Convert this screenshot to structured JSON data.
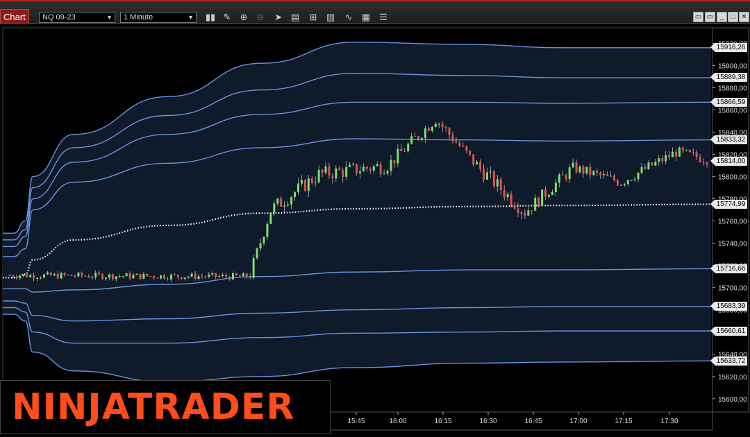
{
  "toolbar": {
    "chart_tab": "Chart",
    "instrument": "NQ 09-23",
    "interval": "1 Minute",
    "tools": [
      "bar-type-icon",
      "pencil-icon",
      "zoom-in-icon",
      "zoom-out-icon",
      "pointer-icon",
      "data-box-icon",
      "chart-properties-icon",
      "strategies-icon",
      "indicators-icon",
      "templates-icon"
    ],
    "window_controls": [
      "restore-icon",
      "restore-alt-icon",
      "minimize-icon",
      "maximize-icon",
      "close-icon"
    ]
  },
  "logo": "NINJATRADER",
  "colors": {
    "background": "#000000",
    "band_line": "#6b93e0",
    "band_fill": "#0f1a2a",
    "up_candle": "#7ddf6a",
    "down_candle": "#e05050",
    "vwap": "#ffffff",
    "logo": "#ff4e1a"
  },
  "chart_data": {
    "type": "candlestick",
    "instrument": "NQ 09-23",
    "interval": "1 Minute",
    "x_ticks": [
      "15:45",
      "16:00",
      "16:15",
      "16:30",
      "16:45",
      "17:00",
      "17:15",
      "17:30"
    ],
    "y_ticks": [
      15920,
      15900,
      15880,
      15860,
      15840,
      15820,
      15800,
      15780,
      15760,
      15740,
      15720,
      15700,
      15680,
      15660,
      15640,
      15620,
      15600
    ],
    "y_tick_labels": [
      "15920,00",
      "15900,00",
      "15880,00",
      "15860,00",
      "15840,00",
      "15820,00",
      "15800,00",
      "15780,00",
      "15760,00",
      "15740,00",
      "15720,00",
      "15700,00",
      "15680,00",
      "15660,00",
      "15640,00",
      "15620,00",
      "15600,00"
    ],
    "ylim": [
      15588,
      15934
    ],
    "price_markers": [
      {
        "label": "15916,26",
        "value": 15916.26
      },
      {
        "label": "15889,38",
        "value": 15889.38
      },
      {
        "label": "15866,59",
        "value": 15866.59
      },
      {
        "label": "15833,32",
        "value": 15833.32
      },
      {
        "label": "15814,00",
        "value": 15814.0
      },
      {
        "label": "15774,99",
        "value": 15774.99
      },
      {
        "label": "15716,66",
        "value": 15716.66
      },
      {
        "label": "15683,39",
        "value": 15683.39
      },
      {
        "label": "15660,61",
        "value": 15660.61
      },
      {
        "label": "15633,72",
        "value": 15633.72
      }
    ],
    "series": [
      {
        "name": "upper-band-3",
        "points": [
          [
            15721,
            15749
          ],
          [
            15724,
            15749
          ],
          [
            15727,
            15760
          ],
          [
            15729,
            15800
          ],
          [
            15740,
            15838
          ],
          [
            15765,
            15872
          ],
          [
            15790,
            15902
          ],
          [
            15815,
            15921
          ],
          [
            15845,
            15919
          ],
          [
            15870,
            15916
          ],
          [
            15910,
            15916
          ]
        ]
      },
      {
        "name": "upper-band-2",
        "points": [
          [
            15721,
            15743
          ],
          [
            15724,
            15743
          ],
          [
            15727,
            15752
          ],
          [
            15729,
            15790
          ],
          [
            15740,
            15826
          ],
          [
            15765,
            15855
          ],
          [
            15790,
            15878
          ],
          [
            15815,
            15893
          ],
          [
            15845,
            15891
          ],
          [
            15870,
            15889
          ],
          [
            15910,
            15889
          ]
        ]
      },
      {
        "name": "upper-band-1",
        "points": [
          [
            15721,
            15737
          ],
          [
            15724,
            15737
          ],
          [
            15727,
            15746
          ],
          [
            15729,
            15780
          ],
          [
            15740,
            15813
          ],
          [
            15765,
            15838
          ],
          [
            15790,
            15856
          ],
          [
            15815,
            15867
          ],
          [
            15845,
            15867
          ],
          [
            15870,
            15866
          ],
          [
            15910,
            15867
          ]
        ]
      },
      {
        "name": "upper-band-0",
        "points": [
          [
            15721,
            15728
          ],
          [
            15724,
            15728
          ],
          [
            15727,
            15735
          ],
          [
            15729,
            15770
          ],
          [
            15740,
            15795
          ],
          [
            15765,
            15812
          ],
          [
            15790,
            15826
          ],
          [
            15815,
            15834
          ],
          [
            15845,
            15833
          ],
          [
            15870,
            15832
          ],
          [
            15910,
            15833
          ]
        ]
      },
      {
        "name": "vwap",
        "points": [
          [
            15721,
            15709
          ],
          [
            15724,
            15709
          ],
          [
            15727,
            15712
          ],
          [
            15729,
            15725
          ],
          [
            15740,
            15743
          ],
          [
            15765,
            15756
          ],
          [
            15790,
            15767
          ],
          [
            15815,
            15771
          ],
          [
            15845,
            15773
          ],
          [
            15870,
            15774
          ],
          [
            15910,
            15775
          ]
        ]
      },
      {
        "name": "lower-band-0",
        "points": [
          [
            15721,
            15699
          ],
          [
            15724,
            15699
          ],
          [
            15727,
            15699
          ],
          [
            15729,
            15696
          ],
          [
            15740,
            15698
          ],
          [
            15765,
            15703
          ],
          [
            15790,
            15710
          ],
          [
            15815,
            15714
          ],
          [
            15845,
            15716
          ],
          [
            15870,
            15716
          ],
          [
            15910,
            15717
          ]
        ]
      },
      {
        "name": "lower-band-1",
        "points": [
          [
            15721,
            15688
          ],
          [
            15724,
            15688
          ],
          [
            15727,
            15686
          ],
          [
            15729,
            15675
          ],
          [
            15740,
            15670
          ],
          [
            15765,
            15672
          ],
          [
            15790,
            15677
          ],
          [
            15815,
            15680
          ],
          [
            15845,
            15682
          ],
          [
            15870,
            15683
          ],
          [
            15910,
            15683
          ]
        ]
      },
      {
        "name": "lower-band-2",
        "points": [
          [
            15721,
            15682
          ],
          [
            15724,
            15682
          ],
          [
            15727,
            15678
          ],
          [
            15729,
            15660
          ],
          [
            15740,
            15650
          ],
          [
            15765,
            15650
          ],
          [
            15790,
            15655
          ],
          [
            15815,
            15659
          ],
          [
            15845,
            15660
          ],
          [
            15870,
            15661
          ],
          [
            15910,
            15661
          ]
        ]
      },
      {
        "name": "lower-band-3",
        "points": [
          [
            15721,
            15676
          ],
          [
            15724,
            15676
          ],
          [
            15727,
            15670
          ],
          [
            15729,
            15642
          ],
          [
            15740,
            15625
          ],
          [
            15765,
            15615
          ],
          [
            15790,
            15620
          ],
          [
            15815,
            15628
          ],
          [
            15845,
            15632
          ],
          [
            15870,
            15633
          ],
          [
            15910,
            15634
          ]
        ]
      }
    ],
    "candles_segments": [
      {
        "from_close": 15711,
        "to_close": 15710,
        "count": 70,
        "volatility": 3
      },
      {
        "from_close": 15712,
        "to_close": 15770,
        "count": 6,
        "volatility": 6
      },
      {
        "from_close": 15770,
        "to_close": 15802,
        "count": 14,
        "volatility": 7
      },
      {
        "from_close": 15802,
        "to_close": 15810,
        "count": 20,
        "volatility": 7
      },
      {
        "from_close": 15810,
        "to_close": 15852,
        "count": 14,
        "volatility": 6
      },
      {
        "from_close": 15852,
        "to_close": 15810,
        "count": 12,
        "volatility": 6
      },
      {
        "from_close": 15810,
        "to_close": 15768,
        "count": 14,
        "volatility": 7
      },
      {
        "from_close": 15768,
        "to_close": 15808,
        "count": 14,
        "volatility": 6
      },
      {
        "from_close": 15808,
        "to_close": 15795,
        "count": 14,
        "volatility": 5
      },
      {
        "from_close": 15795,
        "to_close": 15822,
        "count": 16,
        "volatility": 5
      },
      {
        "from_close": 15822,
        "to_close": 15815,
        "count": 10,
        "volatility": 5
      }
    ]
  }
}
